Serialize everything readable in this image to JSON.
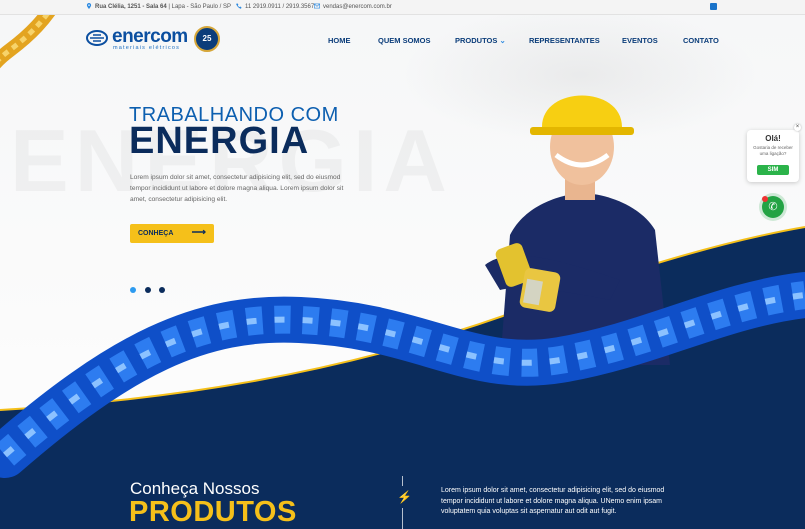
{
  "topbar": {
    "address_bold": "Rua Clélia, 1251 - Sala 64",
    "address_rest": "| Lapa - São Paulo / SP",
    "phones": "11 2919.0911 / 2919.3567",
    "email": "vendas@enercom.com.br"
  },
  "logo": {
    "name": "enercom",
    "tagline": "materiais elétricos",
    "badge": "25"
  },
  "nav": [
    "HOME",
    "QUEM SOMOS",
    "PRODUTOS",
    "REPRESENTANTES",
    "EVENTOS",
    "CONTATO"
  ],
  "hero": {
    "kicker": "TRABALHANDO COM",
    "headline": "ENERGIA",
    "ghost_word": "ENERGIA",
    "body": "Lorem ipsum dolor sit amet, consectetur adipisicing elit, sed do eiusmod tempor incididunt ut labore et dolore magna aliqua. Lorem ipsum dolor sit amet, consectetur adipisicing elit.",
    "cta": "CONHEÇA"
  },
  "slider": {
    "count": 3,
    "active": 1
  },
  "chat": {
    "title": "Olá!",
    "text": "Gostaria de receber uma ligação?",
    "button": "SIM"
  },
  "section": {
    "small": "Conheça Nossos",
    "big": "PRODUTOS",
    "text": "Lorem ipsum dolor sit amet, consectetur adipisicing elit, sed do eiusmod tempor incididunt ut labore et dolore magna aliqua. UNemo enim ipsam voluptatem quia voluptas sit aspernatur aut odit aut fugit."
  },
  "colors": {
    "navy": "#0b2c5c",
    "brand_blue": "#0d5fb0",
    "yellow": "#f5c01a",
    "green": "#23a344"
  }
}
